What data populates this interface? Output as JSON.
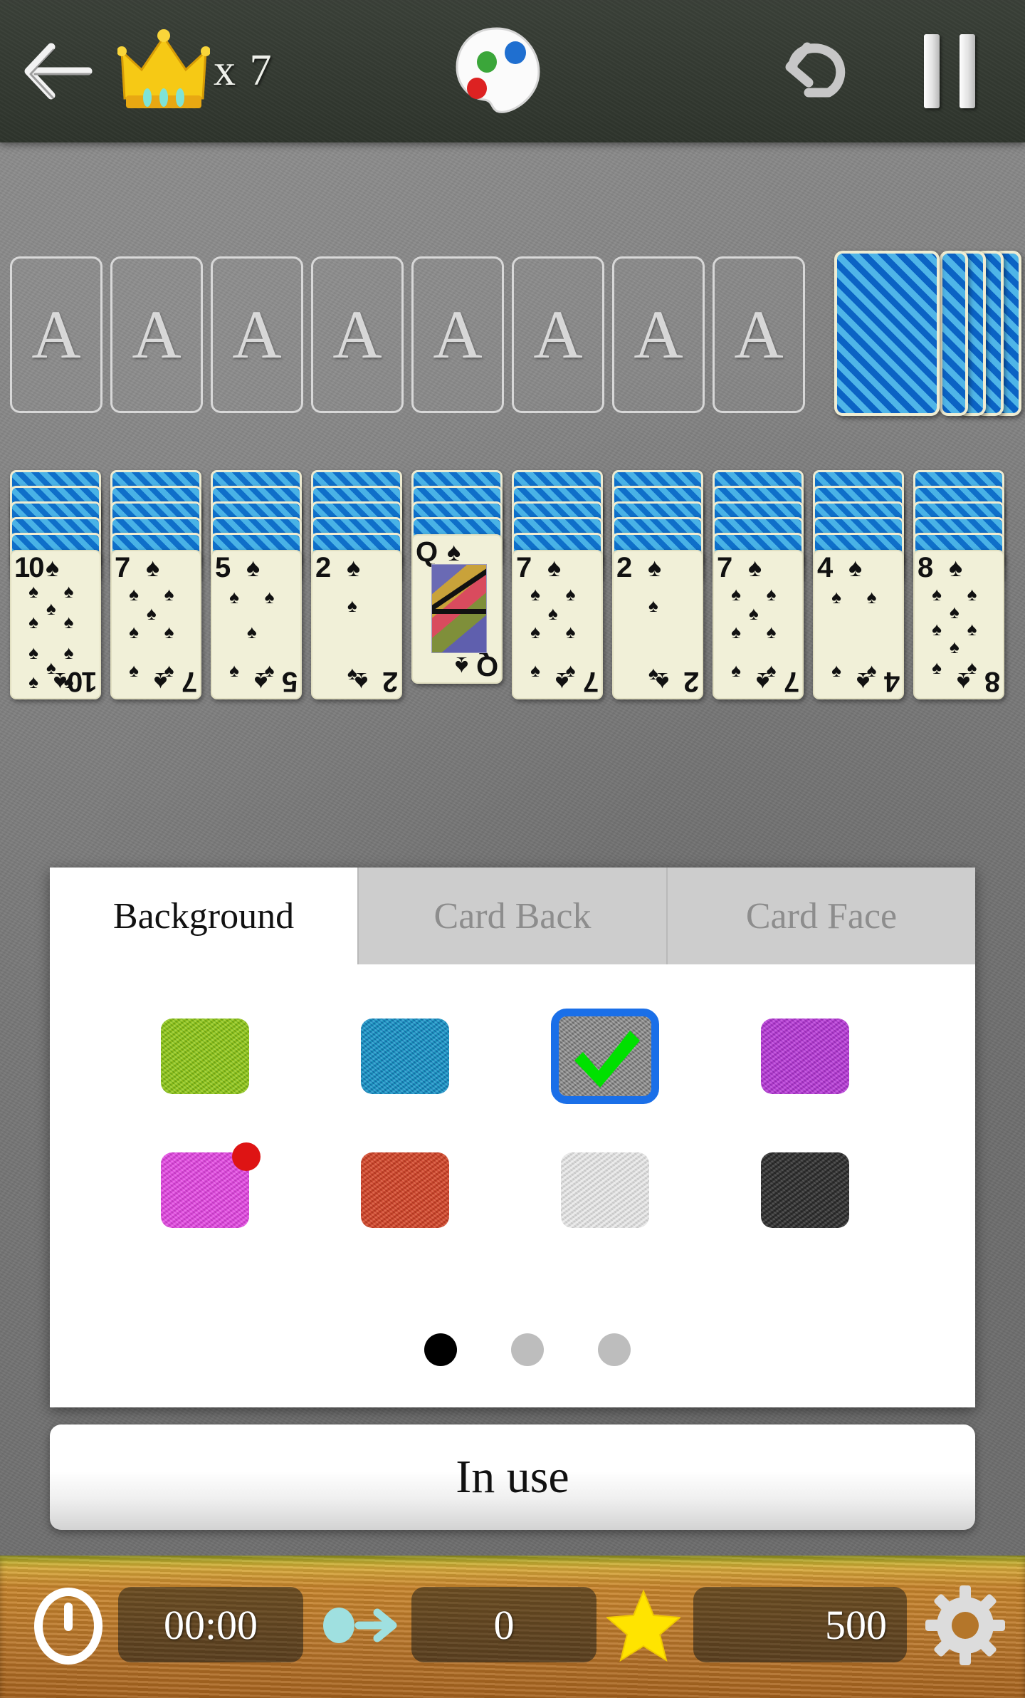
{
  "topbar": {
    "back_icon": "back-arrow-icon",
    "crown_icon": "crown-icon",
    "crown_count": "x 7",
    "palette_icon": "paint-palette-icon",
    "undo_icon": "undo-arrow-icon",
    "pause_icon": "pause-icon"
  },
  "board": {
    "foundations": [
      {
        "label": "A"
      },
      {
        "label": "A"
      },
      {
        "label": "A"
      },
      {
        "label": "A"
      },
      {
        "label": "A"
      },
      {
        "label": "A"
      },
      {
        "label": "A"
      },
      {
        "label": "A"
      }
    ],
    "stock": {
      "name": "stock-pile",
      "cards_shown": 5
    },
    "tableau": [
      {
        "facedown": 5,
        "rank": "10",
        "suit": "♠",
        "pips": 10
      },
      {
        "facedown": 5,
        "rank": "7",
        "suit": "♠",
        "pips": 7
      },
      {
        "facedown": 5,
        "rank": "5",
        "suit": "♠",
        "pips": 5
      },
      {
        "facedown": 5,
        "rank": "2",
        "suit": "♠",
        "pips": 2
      },
      {
        "facedown": 4,
        "rank": "Q",
        "suit": "♠",
        "pips": 0
      },
      {
        "facedown": 5,
        "rank": "7",
        "suit": "♠",
        "pips": 7
      },
      {
        "facedown": 5,
        "rank": "2",
        "suit": "♠",
        "pips": 2
      },
      {
        "facedown": 5,
        "rank": "7",
        "suit": "♠",
        "pips": 7
      },
      {
        "facedown": 5,
        "rank": "4",
        "suit": "♠",
        "pips": 4
      },
      {
        "facedown": 5,
        "rank": "8",
        "suit": "♠",
        "pips": 8
      }
    ]
  },
  "panel": {
    "tabs": [
      {
        "label": "Background",
        "active": true
      },
      {
        "label": "Card Back",
        "active": false
      },
      {
        "label": "Card Face",
        "active": false
      }
    ],
    "swatches": [
      {
        "name": "green",
        "color": "#8cc41c",
        "selected": false,
        "badge": false
      },
      {
        "name": "blue",
        "color": "#1b8fc4",
        "selected": false,
        "badge": false
      },
      {
        "name": "gray",
        "color": "#8a8a8a",
        "selected": true,
        "badge": false
      },
      {
        "name": "purple",
        "color": "#b43bd4",
        "selected": false,
        "badge": false
      },
      {
        "name": "pink",
        "color": "#e14ae0",
        "selected": false,
        "badge": true
      },
      {
        "name": "red",
        "color": "#d0462b",
        "selected": false,
        "badge": false
      },
      {
        "name": "white",
        "color": "#e6e6e6",
        "selected": false,
        "badge": false
      },
      {
        "name": "charcoal",
        "color": "#2f2f2f",
        "selected": false,
        "badge": false
      }
    ],
    "selected_border_color": "#1a6fe8",
    "check_color": "#00e000",
    "badge_color": "#de1414",
    "pagination": {
      "count": 3,
      "active_index": 0
    },
    "in_use_label": "In use"
  },
  "statusbar": {
    "clock_icon": "clock-icon",
    "time": "00:00",
    "moves_icon": "moves-arrow-icon",
    "moves": "0",
    "star_icon": "star-icon",
    "score": "500",
    "settings_icon": "gear-icon"
  }
}
